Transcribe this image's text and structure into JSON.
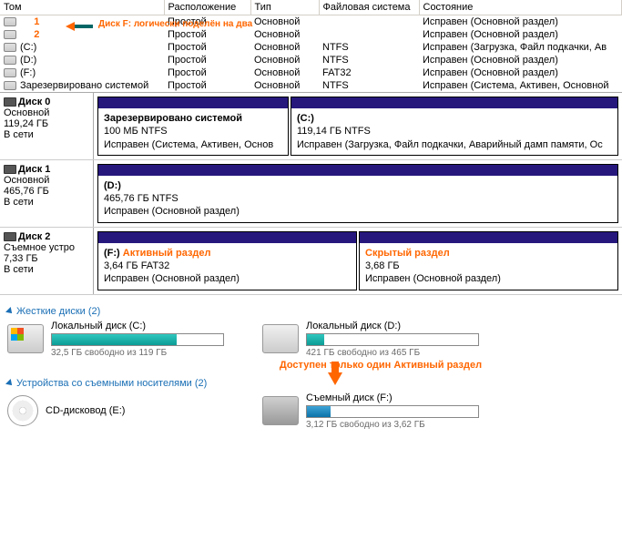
{
  "columns": {
    "c0": "Том",
    "c1": "Расположение",
    "c2": "Тип",
    "c3": "Файловая система",
    "c4": "Состояние"
  },
  "annotations": {
    "top": "Диск F: логически поделён на два",
    "n1": "1",
    "n2": "2",
    "mid": "Доступен только один Активный раздел"
  },
  "vol": [
    {
      "name": "",
      "layout": "Простой",
      "type": "Основной",
      "fs": "",
      "status": "Исправен (Основной раздел)"
    },
    {
      "name": "",
      "layout": "Простой",
      "type": "Основной",
      "fs": "",
      "status": "Исправен (Основной раздел)"
    },
    {
      "name": "(C:)",
      "layout": "Простой",
      "type": "Основной",
      "fs": "NTFS",
      "status": "Исправен (Загрузка, Файл подкачки, Ав"
    },
    {
      "name": "(D:)",
      "layout": "Простой",
      "type": "Основной",
      "fs": "NTFS",
      "status": "Исправен (Основной раздел)"
    },
    {
      "name": "(F:)",
      "layout": "Простой",
      "type": "Основной",
      "fs": "FAT32",
      "status": "Исправен (Основной раздел)"
    },
    {
      "name": "Зарезервировано системой",
      "layout": "Простой",
      "type": "Основной",
      "fs": "NTFS",
      "status": "Исправен (Система, Активен, Основной"
    }
  ],
  "disk0": {
    "label": "Диск 0",
    "type": "Основной",
    "size": "119,24 ГБ",
    "state": "В сети",
    "p0": {
      "title": "Зарезервировано системой",
      "line": "100 МБ NTFS",
      "status": "Исправен (Система, Активен, Основ"
    },
    "p1": {
      "title": "(C:)",
      "line": "119,14 ГБ NTFS",
      "status": "Исправен (Загрузка, Файл подкачки, Аварийный дамп памяти, Ос"
    }
  },
  "disk1": {
    "label": "Диск 1",
    "type": "Основной",
    "size": "465,76 ГБ",
    "state": "В сети",
    "p0": {
      "title": "(D:)",
      "line": "465,76 ГБ NTFS",
      "status": "Исправен (Основной раздел)"
    }
  },
  "disk2": {
    "label": "Диск 2",
    "type": "Съемное устро",
    "size": "7,33 ГБ",
    "state": "В сети",
    "p0": {
      "title": "(F:) ",
      "title2": "Активный раздел",
      "line": "3,64 ГБ FAT32",
      "status": "Исправен (Основной раздел)"
    },
    "p1": {
      "title": "Скрытый раздел",
      "line": "3,68 ГБ",
      "status": "Исправен (Основной раздел)"
    }
  },
  "explorer": {
    "g1": "Жесткие диски (2)",
    "g2": "Устройства со съемными носителями (2)",
    "d_c": {
      "name": "Локальный диск (C:)",
      "free": "32,5 ГБ свободно из 119 ГБ",
      "pct": 73
    },
    "d_d": {
      "name": "Локальный диск (D:)",
      "free": "421 ГБ свободно из 465 ГБ",
      "pct": 10
    },
    "d_e": {
      "name": "CD-дисковод (E:)"
    },
    "d_f": {
      "name": "Съемный диск (F:)",
      "free": "3,12 ГБ свободно из 3,62 ГБ",
      "pct": 14
    }
  }
}
